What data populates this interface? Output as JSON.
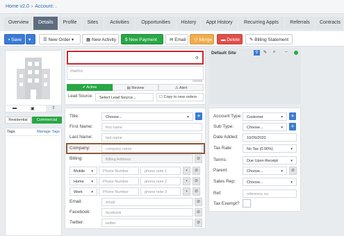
{
  "breadcrumb": {
    "home": "Home v2.0",
    "separator": "›",
    "account": "Account: ."
  },
  "tabs": [
    "Overview",
    "Details",
    "Profile",
    "Sites",
    "Activities",
    "Opportunities",
    "History",
    "Appt History",
    "Recurring Appts",
    "Referrals",
    "Contracts"
  ],
  "toolbar": {
    "save": "Save",
    "new_order": "New Order",
    "new_activity": "New Activity",
    "new_payment": "New Payment",
    "email": "Email",
    "merge": "Merge",
    "delete": "Delete",
    "billing_statement": "Billing Statement"
  },
  "left": {
    "residential": "Residential",
    "commercial": "Commercial",
    "tags_label": "Tags",
    "manage_tags": "Manage Tags"
  },
  "name_block": {
    "name_value": ".",
    "memo_placeholder": "memo",
    "char_count": "0/2048",
    "status_active": "Active",
    "status_review": "Review",
    "status_alert": "Alert",
    "lead_source_label": "Lead Source:",
    "lead_source_value": "Select Lead Source...",
    "copy_orders": "Copy to new orders"
  },
  "contact": {
    "title_label": "Title:",
    "title_value": "Choose...",
    "first_label": "First Name:",
    "first_ph": "first name",
    "last_label": "Last Name:",
    "last_ph": "last name",
    "company_label": "Company:",
    "company_ph": "company name",
    "billing_label": "Billing:",
    "billing_ph": "Billing Address",
    "phones": [
      {
        "type": "Mobile",
        "ph": "Phone Number",
        "note": "phone note 1"
      },
      {
        "type": "Home",
        "ph": "Phone Number",
        "note": "phone note 2"
      },
      {
        "type": "Work",
        "ph": "Phone Number",
        "note": "phone note 3"
      }
    ],
    "email_label": "Email:",
    "email_ph": "email",
    "facebook_label": "Facebook:",
    "facebook_ph": "facebook",
    "twitter_label": "Twitter:",
    "twitter_ph": "twitter"
  },
  "site": {
    "title": "Default Site"
  },
  "account": {
    "type_label": "Account Type:",
    "type_value": "Customer",
    "subtype_label": "Sub Type:",
    "subtype_value": "Choose...",
    "date_label": "Date Added:",
    "date_value": "10/26/2020",
    "tax_label": "Tax Rate:",
    "tax_value": "No Tax (0.00%)",
    "terms_label": "Terms:",
    "terms_value": "Due Upon Receipt",
    "parent_label": "Parent:",
    "parent_value": "Choose...",
    "rep_label": "Sales Rep:",
    "rep_value": "Choose...",
    "ref_label": "Ref:",
    "ref_ph": "reference no.",
    "exempt_label": "Tax Exempt?"
  }
}
